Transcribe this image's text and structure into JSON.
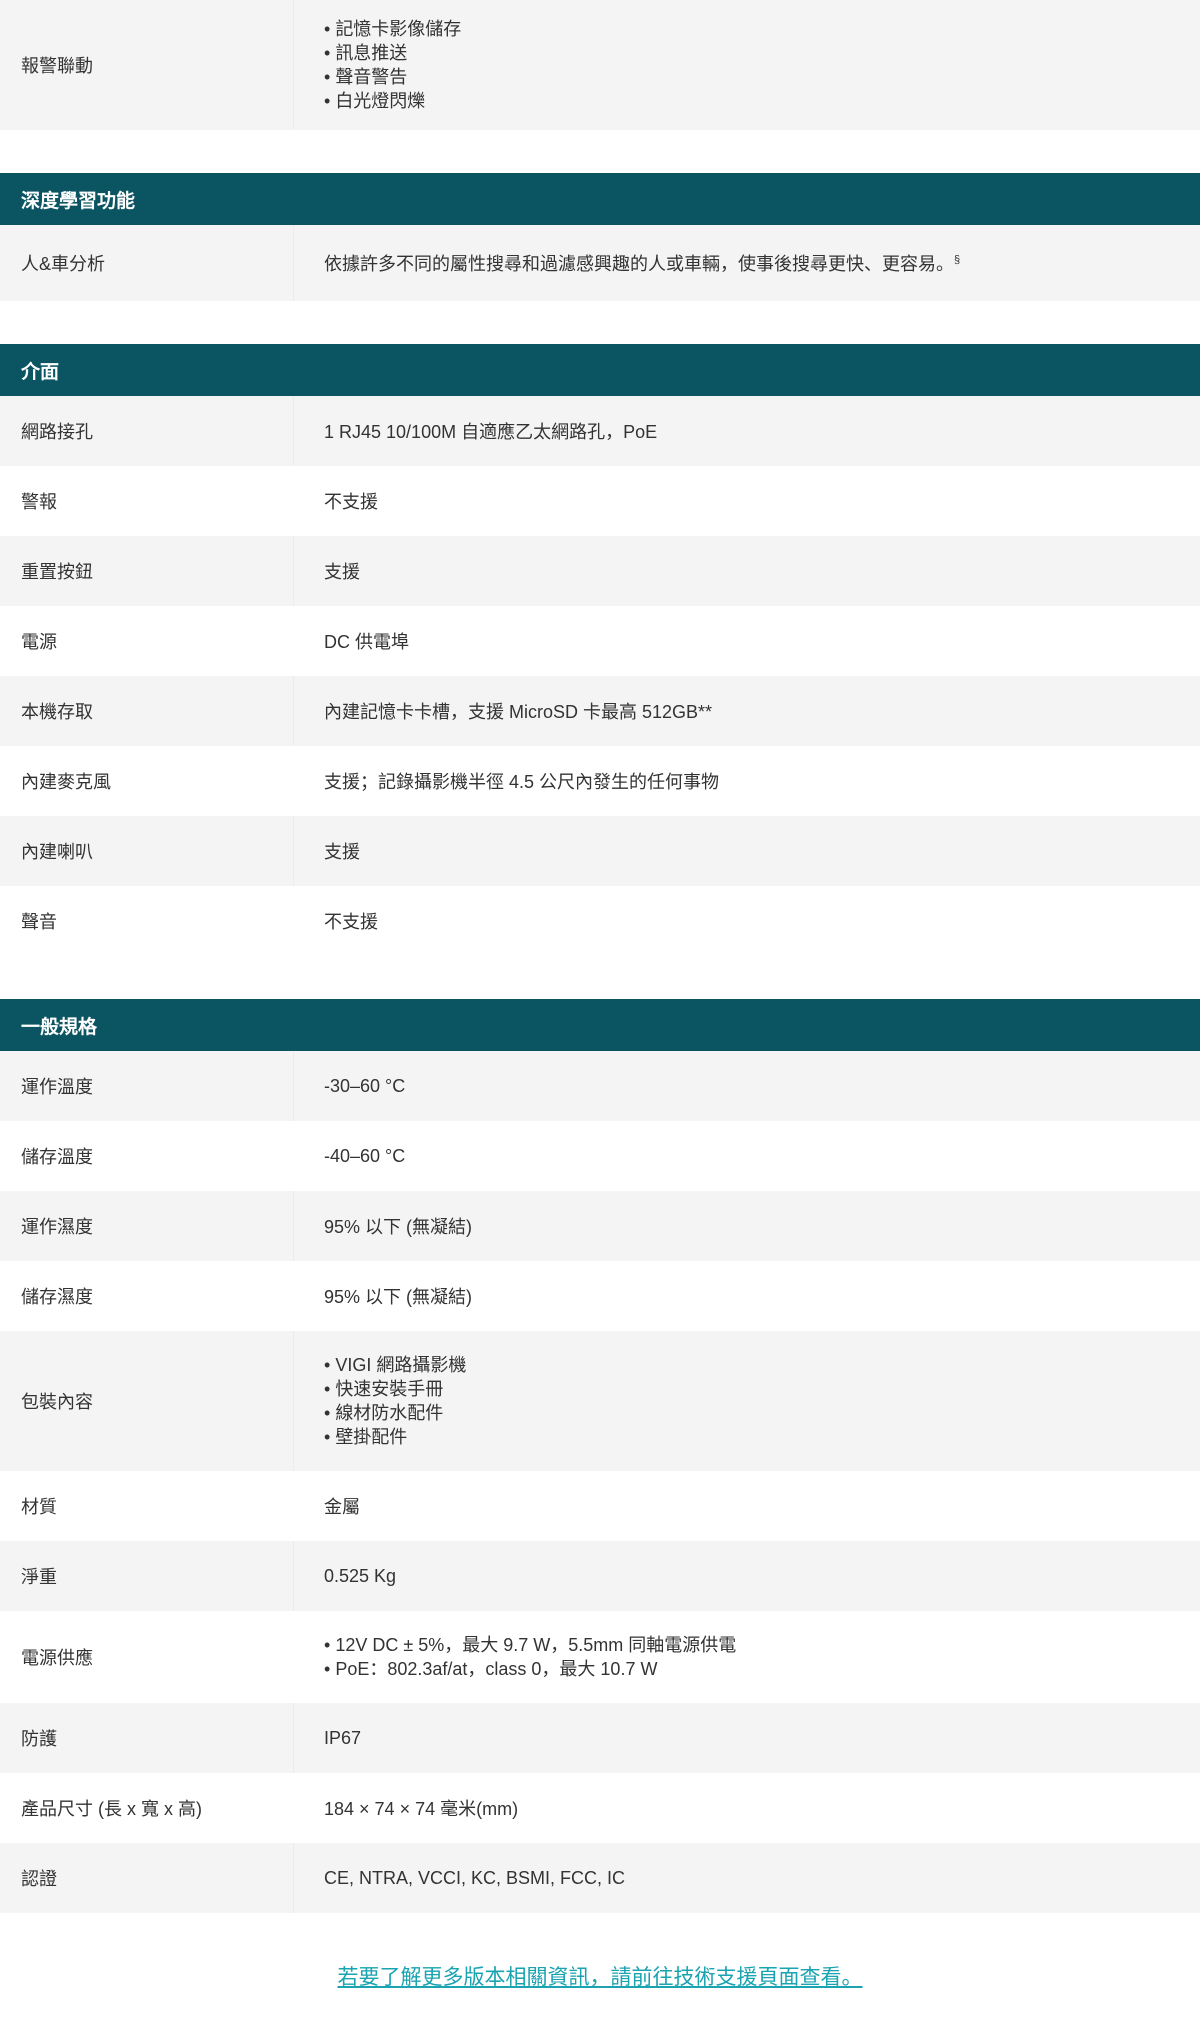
{
  "alarm_linkage": {
    "label": "報警聯動",
    "items": [
      "記憶卡影像儲存",
      "訊息推送",
      "聲音警告",
      "白光燈閃爍"
    ]
  },
  "deep_learning": {
    "header": "深度學習功能",
    "rows": [
      {
        "label": "人&車分析",
        "value": "依據許多不同的屬性搜尋和過濾感興趣的人或車輛，使事後搜尋更快、更容易。",
        "sup": "§"
      }
    ]
  },
  "interface": {
    "header": "介面",
    "rows": [
      {
        "label": "網路接孔",
        "value": "1 RJ45 10/100M 自適應乙太網路孔，PoE"
      },
      {
        "label": "警報",
        "value": "不支援"
      },
      {
        "label": "重置按鈕",
        "value": "支援"
      },
      {
        "label": "電源",
        "value": "DC 供電埠"
      },
      {
        "label": "本機存取",
        "value": "內建記憶卡卡槽，支援 MicroSD 卡最高 512GB**"
      },
      {
        "label": "內建麥克風",
        "value": "支援；記錄攝影機半徑 4.5 公尺內發生的任何事物"
      },
      {
        "label": "內建喇叭",
        "value": "支援"
      },
      {
        "label": "聲音",
        "value": "不支援"
      }
    ]
  },
  "general": {
    "header": "一般規格",
    "rows": [
      {
        "label": "運作溫度",
        "value": "-30–60 °C"
      },
      {
        "label": "儲存溫度",
        "value": "-40–60 °C"
      },
      {
        "label": "運作濕度",
        "value": "95% 以下 (無凝結)"
      },
      {
        "label": "儲存濕度",
        "value": "95% 以下 (無凝結)"
      }
    ],
    "package": {
      "label": "包裝內容",
      "items": [
        "VIGI 網路攝影機",
        "快速安裝手冊",
        "線材防水配件",
        "壁掛配件"
      ]
    },
    "material": {
      "label": "材質",
      "value": "金屬"
    },
    "weight": {
      "label": "淨重",
      "value": "0.525 Kg"
    },
    "power_supply": {
      "label": "電源供應",
      "items": [
        "12V DC ± 5%，最大 9.7 W，5.5mm 同軸電源供電",
        "PoE：802.3af/at，class 0，最大 10.7 W"
      ]
    },
    "rows2": [
      {
        "label": "防護",
        "value": "IP67"
      },
      {
        "label": "產品尺寸 (長 x 寬 x 高)",
        "value": "184 × 74 × 74 毫米(mm)"
      },
      {
        "label": "認證",
        "value": "CE, NTRA, VCCI, KC, BSMI, FCC, IC"
      }
    ]
  },
  "footer": {
    "link_text": "若要了解更多版本相關資訊，請前往技術支援頁面查看。"
  },
  "colors": {
    "header_bg": "#0b5563",
    "alt_row_bg": "#f4f4f4",
    "link": "#1aa3b0"
  }
}
